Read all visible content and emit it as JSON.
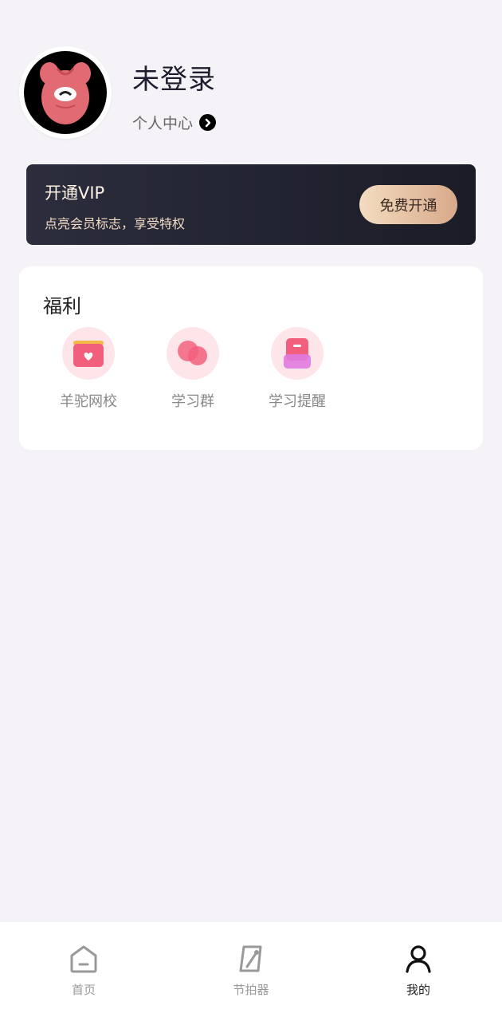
{
  "profile": {
    "username": "未登录",
    "center_label": "个人中心"
  },
  "vip": {
    "title": "开通VIP",
    "subtitle": "点亮会员标志，享受特权",
    "button_label": "免费开通"
  },
  "benefits": {
    "title": "福利",
    "items": [
      {
        "label": "羊驼网校",
        "icon": "gift-box-icon"
      },
      {
        "label": "学习群",
        "icon": "group-icon"
      },
      {
        "label": "学习提醒",
        "icon": "reminder-icon"
      }
    ]
  },
  "bottom_nav": {
    "items": [
      {
        "label": "首页",
        "icon": "home-icon",
        "active": false
      },
      {
        "label": "节拍器",
        "icon": "metronome-icon",
        "active": false
      },
      {
        "label": "我的",
        "icon": "person-icon",
        "active": true
      }
    ]
  },
  "colors": {
    "page_bg": "#f5f3f7",
    "vip_bg": "#1b1c27",
    "vip_button": "#d8a98a",
    "benefit_icon_bg": "#fde5ea",
    "benefit_icon_pink": "#f25f7c"
  }
}
